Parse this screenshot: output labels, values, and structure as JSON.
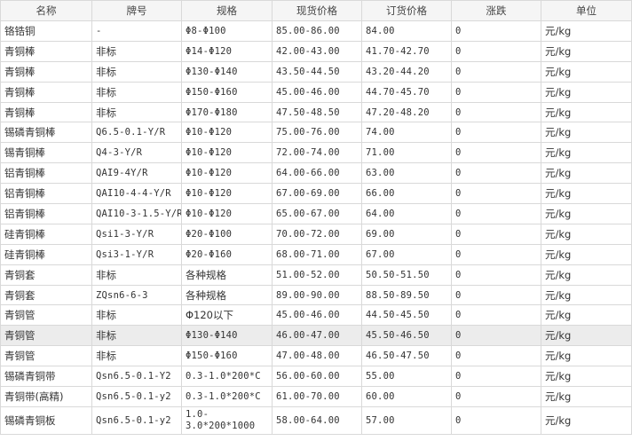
{
  "table": {
    "columns": [
      "名称",
      "牌号",
      "规格",
      "现货价格",
      "订货价格",
      "涨跌",
      "单位"
    ],
    "rows": [
      {
        "name": "铬锆铜",
        "grade": "-",
        "spec": "Φ8-Φ100",
        "spot": "85.00-86.00",
        "order": "84.00",
        "change": "0",
        "unit": "元/kg"
      },
      {
        "name": "青铜棒",
        "grade": "非标",
        "spec": "Φ14-Φ120",
        "spot": "42.00-43.00",
        "order": "41.70-42.70",
        "change": "0",
        "unit": "元/kg"
      },
      {
        "name": "青铜棒",
        "grade": "非标",
        "spec": "Φ130-Φ140",
        "spot": "43.50-44.50",
        "order": "43.20-44.20",
        "change": "0",
        "unit": "元/kg"
      },
      {
        "name": "青铜棒",
        "grade": "非标",
        "spec": "Φ150-Φ160",
        "spot": "45.00-46.00",
        "order": "44.70-45.70",
        "change": "0",
        "unit": "元/kg"
      },
      {
        "name": "青铜棒",
        "grade": "非标",
        "spec": "Φ170-Φ180",
        "spot": "47.50-48.50",
        "order": "47.20-48.20",
        "change": "0",
        "unit": "元/kg"
      },
      {
        "name": "锡磷青铜棒",
        "grade": "Q6.5-0.1-Y/R",
        "spec": "Φ10-Φ120",
        "spot": "75.00-76.00",
        "order": "74.00",
        "change": "0",
        "unit": "元/kg"
      },
      {
        "name": "锡青铜棒",
        "grade": "Q4-3-Y/R",
        "spec": "Φ10-Φ120",
        "spot": "72.00-74.00",
        "order": "71.00",
        "change": "0",
        "unit": "元/kg"
      },
      {
        "name": "铝青铜棒",
        "grade": "QAI9-4Y/R",
        "spec": "Φ10-Φ120",
        "spot": "64.00-66.00",
        "order": "63.00",
        "change": "0",
        "unit": "元/kg"
      },
      {
        "name": "铝青铜棒",
        "grade": "QAI10-4-4-Y/R",
        "spec": "Φ10-Φ120",
        "spot": "67.00-69.00",
        "order": "66.00",
        "change": "0",
        "unit": "元/kg"
      },
      {
        "name": "铝青铜棒",
        "grade": "QAI10-3-1.5-Y/R",
        "spec": "Φ10-Φ120",
        "spot": "65.00-67.00",
        "order": "64.00",
        "change": "0",
        "unit": "元/kg"
      },
      {
        "name": "硅青铜棒",
        "grade": "Qsi1-3-Y/R",
        "spec": "Φ20-Φ100",
        "spot": "70.00-72.00",
        "order": "69.00",
        "change": "0",
        "unit": "元/kg"
      },
      {
        "name": "硅青铜棒",
        "grade": "Qsi3-1-Y/R",
        "spec": "Φ20-Φ160",
        "spot": "68.00-71.00",
        "order": "67.00",
        "change": "0",
        "unit": "元/kg"
      },
      {
        "name": "青铜套",
        "grade": "非标",
        "spec": "各种规格",
        "spot": "51.00-52.00",
        "order": "50.50-51.50",
        "change": "0",
        "unit": "元/kg"
      },
      {
        "name": "青铜套",
        "grade": "ZQsn6-6-3",
        "spec": "各种规格",
        "spot": "89.00-90.00",
        "order": "88.50-89.50",
        "change": "0",
        "unit": "元/kg"
      },
      {
        "name": "青铜管",
        "grade": "非标",
        "spec": "Φ120以下",
        "spot": "45.00-46.00",
        "order": "44.50-45.50",
        "change": "0",
        "unit": "元/kg"
      },
      {
        "name": "青铜管",
        "grade": "非标",
        "spec": "Φ130-Φ140",
        "spot": "46.00-47.00",
        "order": "45.50-46.50",
        "change": "0",
        "unit": "元/kg"
      },
      {
        "name": "青铜管",
        "grade": "非标",
        "spec": "Φ150-Φ160",
        "spot": "47.00-48.00",
        "order": "46.50-47.50",
        "change": "0",
        "unit": "元/kg"
      },
      {
        "name": "锡磷青铜带",
        "grade": "Qsn6.5-0.1-Y2",
        "spec": "0.3-1.0*200*C",
        "spot": "56.00-60.00",
        "order": "55.00",
        "change": "0",
        "unit": "元/kg"
      },
      {
        "name": "青铜带(高精)",
        "grade": "Qsn6.5-0.1-y2",
        "spec": "0.3-1.0*200*C",
        "spot": "61.00-70.00",
        "order": "60.00",
        "change": "0",
        "unit": "元/kg"
      },
      {
        "name": "锡磷青铜板",
        "grade": "Qsn6.5-0.1-y2",
        "spec": "1.0-3.0*200*1000",
        "spot": "58.00-64.00",
        "order": "57.00",
        "change": "0",
        "unit": "元/kg"
      }
    ]
  }
}
